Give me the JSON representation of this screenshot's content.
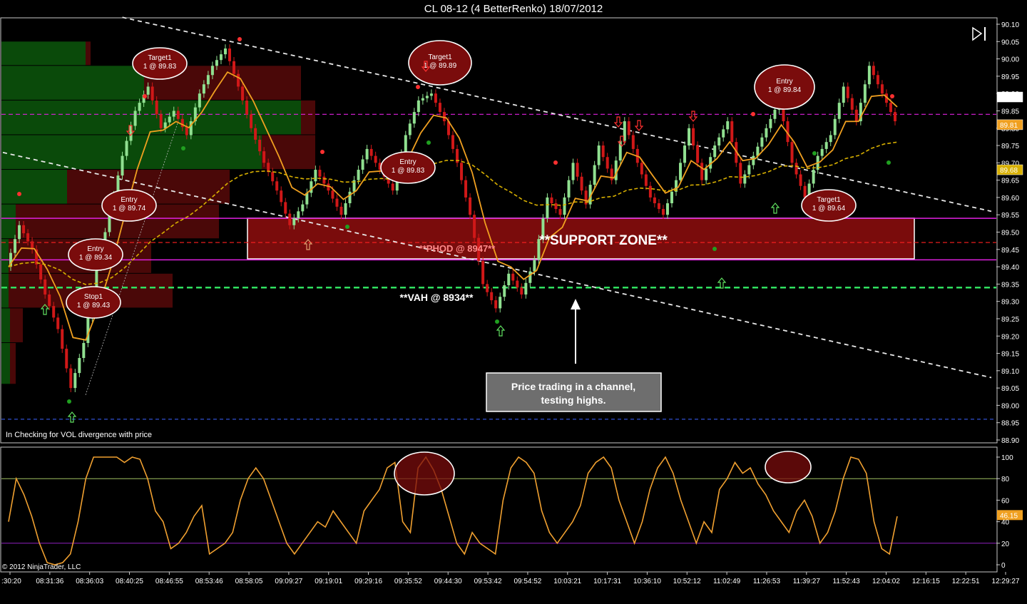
{
  "title": "CL 08-12 (4 BetterRenko)  18/07/2012",
  "copyright": "© 2012 NinjaTrader, LLC",
  "indicator_note": "In  Checking for VOL  divergence with price",
  "annotations": {
    "support_zone": "**SUPPORT ZONE**",
    "phod": "**PHOD @ 8947**",
    "vah": "**VAH @ 8934**",
    "callout_line1": "Price trading in a channel,",
    "callout_line2": "testing highs."
  },
  "colors": {
    "background": "#000000",
    "bull": "#90e090",
    "bear": "#d01818",
    "ema_fast": "#f0a020",
    "ema_slow": "#d8b000",
    "stoch": "#f0a030",
    "magenta": "#e020e0",
    "green_dashed": "#30e060",
    "zone": "#7a0c0c"
  },
  "chart_data": [
    {
      "type": "candlestick",
      "title": "CL 08-12 (4 BetterRenko)  18/07/2012",
      "x_ticks": [
        ":30:20",
        "08:31:36",
        "08:36:03",
        "08:40:25",
        "08:46:55",
        "08:53:46",
        "08:58:05",
        "09:09:27",
        "09:19:01",
        "09:29:16",
        "09:35:52",
        "09:44:30",
        "09:53:42",
        "09:54:52",
        "10:03:21",
        "10:17:31",
        "10:36:10",
        "10:52:12",
        "11:02:49",
        "11:26:53",
        "11:39:27",
        "11:52:43",
        "12:04:02",
        "12:16:15",
        "12:22:51",
        "12:29:27"
      ],
      "y_ticks": [
        "90.10",
        "90.05",
        "90.00",
        "89.95",
        "89.90",
        "89.85",
        "89.80",
        "89.75",
        "89.70",
        "89.65",
        "89.60",
        "89.55",
        "89.50",
        "89.45",
        "89.40",
        "89.35",
        "89.30",
        "89.25",
        "89.20",
        "89.15",
        "89.10",
        "89.05",
        "89.00",
        "88.95",
        "88.90"
      ],
      "ylim": [
        88.89,
        90.1
      ],
      "price_flags": [
        {
          "value": 89.89,
          "label": "89.89",
          "color": "#ffffff"
        },
        {
          "value": 89.81,
          "label": "89.81",
          "color": "#f0a020"
        },
        {
          "value": 89.68,
          "label": "89.68",
          "color": "#d8b000"
        }
      ],
      "close_path": [
        89.4,
        89.52,
        89.45,
        89.32,
        89.22,
        89.05,
        89.18,
        89.4,
        89.55,
        89.72,
        89.85,
        89.92,
        89.8,
        89.85,
        89.78,
        89.9,
        89.98,
        90.03,
        89.92,
        89.8,
        89.7,
        89.62,
        89.52,
        89.58,
        89.68,
        89.62,
        89.55,
        89.65,
        89.74,
        89.68,
        89.62,
        89.78,
        89.88,
        89.9,
        89.82,
        89.7,
        89.55,
        89.35,
        89.28,
        89.38,
        89.32,
        89.42,
        89.6,
        89.55,
        89.7,
        89.58,
        89.75,
        89.65,
        89.82,
        89.7,
        89.6,
        89.55,
        89.65,
        89.8,
        89.65,
        89.75,
        89.82,
        89.64,
        89.72,
        89.8,
        89.88,
        89.7,
        89.6,
        89.72,
        89.78,
        89.92,
        89.82,
        89.98,
        89.9,
        89.82
      ],
      "channel_lines": [
        {
          "name": "upper",
          "from": {
            "x": "08:40:25",
            "y": 90.12
          },
          "to": {
            "x": "12:29:27",
            "y": 89.56
          }
        },
        {
          "name": "lower",
          "from": {
            "x": ":30:20",
            "y": 89.73
          },
          "to": {
            "x": "12:29:27",
            "y": 89.08
          }
        }
      ],
      "horizontal_levels": [
        {
          "name": "magenta_dashed",
          "value": 89.84
        },
        {
          "name": "zone_top",
          "value": 89.54
        },
        {
          "name": "phod",
          "value": 89.47
        },
        {
          "name": "zone_bottom",
          "value": 89.42
        },
        {
          "name": "vah",
          "value": 89.34
        },
        {
          "name": "blue_dashed",
          "value": 88.96
        }
      ],
      "trade_markers": [
        {
          "label": "Target1",
          "detail": "1 @ 89.83"
        },
        {
          "label": "Entry",
          "detail": "1 @ 89.74"
        },
        {
          "label": "Entry",
          "detail": "1 @ 89.34"
        },
        {
          "label": "Stop1",
          "detail": "1 @ 89.43"
        },
        {
          "label": "Target1",
          "detail": "1 @ 89.89"
        },
        {
          "label": "Entry",
          "detail": "1 @ 89.83"
        },
        {
          "label": "Entry",
          "detail": "1 @ 89.84"
        },
        {
          "label": "Target1",
          "detail": "1 @ 89.64"
        }
      ]
    },
    {
      "type": "line",
      "y_ticks": [
        "100",
        "80",
        "60",
        "46.15",
        "40",
        "20",
        "0"
      ],
      "ylim": [
        -6,
        106
      ],
      "levels": [
        80,
        20
      ],
      "last_value": "46.15",
      "values": [
        40,
        80,
        65,
        45,
        20,
        2,
        0,
        2,
        10,
        40,
        80,
        100,
        100,
        100,
        100,
        95,
        100,
        98,
        80,
        50,
        40,
        15,
        20,
        30,
        45,
        55,
        10,
        15,
        20,
        30,
        60,
        80,
        90,
        80,
        60,
        40,
        20,
        10,
        20,
        30,
        40,
        35,
        50,
        40,
        30,
        20,
        50,
        60,
        70,
        90,
        95,
        40,
        30,
        90,
        100,
        88,
        70,
        45,
        20,
        10,
        30,
        20,
        15,
        10,
        60,
        90,
        100,
        95,
        85,
        50,
        30,
        20,
        30,
        40,
        55,
        85,
        95,
        100,
        90,
        60,
        40,
        20,
        40,
        70,
        90,
        100,
        85,
        60,
        40,
        20,
        40,
        30,
        70,
        80,
        95,
        85,
        90,
        75,
        65,
        50,
        40,
        30,
        50,
        60,
        45,
        20,
        30,
        50,
        80,
        100,
        98,
        85,
        40,
        15,
        10,
        45
      ]
    }
  ]
}
